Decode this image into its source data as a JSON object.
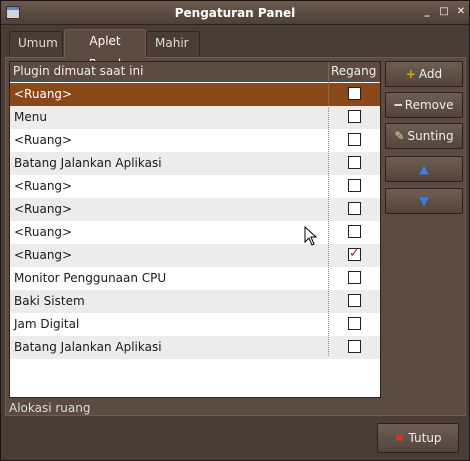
{
  "window": {
    "title": "Pengaturan Panel"
  },
  "tabs": [
    {
      "label": "Umum"
    },
    {
      "label": "Aplet Panel"
    },
    {
      "label": "Mahir"
    }
  ],
  "list": {
    "headers": {
      "plugin": "Plugin dimuat saat ini",
      "stretch": "Regang"
    },
    "rows": [
      {
        "label": "<Ruang>",
        "checked": false,
        "selected": true
      },
      {
        "label": "Menu",
        "checked": false
      },
      {
        "label": "<Ruang>",
        "checked": false
      },
      {
        "label": "Batang Jalankan Aplikasi",
        "checked": false
      },
      {
        "label": "<Ruang>",
        "checked": false
      },
      {
        "label": "<Ruang>",
        "checked": false
      },
      {
        "label": "<Ruang>",
        "checked": false
      },
      {
        "label": "<Ruang>",
        "checked": true
      },
      {
        "label": "Monitor Penggunaan CPU",
        "checked": false
      },
      {
        "label": "Baki Sistem",
        "checked": false
      },
      {
        "label": "Jam Digital",
        "checked": false
      },
      {
        "label": "Batang Jalankan Aplikasi",
        "checked": false
      }
    ]
  },
  "buttons": {
    "add": {
      "label": "Add",
      "icon": "plus-icon"
    },
    "remove": {
      "label": "Remove",
      "icon": "minus-icon"
    },
    "edit": {
      "label": "Sunting",
      "icon": "edit-icon"
    },
    "up": {
      "icon": "arrow-up-icon"
    },
    "down": {
      "icon": "arrow-down-icon"
    },
    "close": {
      "label": "Tutup",
      "icon": "close-icon"
    }
  },
  "status": "Alokasi ruang",
  "colors": {
    "selected": "#8a4717",
    "accent": "#d98a1c"
  }
}
